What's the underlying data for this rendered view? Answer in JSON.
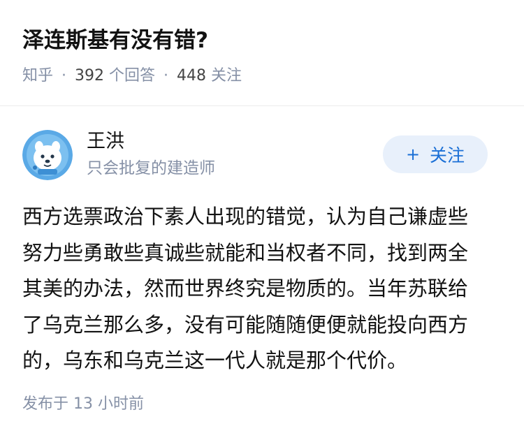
{
  "question": {
    "title": "泽连斯基有没有错?",
    "source": "知乎",
    "answer_count": "392",
    "answer_label": "个回答",
    "follower_count": "448",
    "follower_label": "关注"
  },
  "author": {
    "name": "王洪",
    "headline": "只会批复的建造师",
    "avatar": "robot-dog-avatar-icon",
    "follow_label": "关注",
    "follow_icon": "+"
  },
  "answer": {
    "lines": [
      "西方选票政治下素人出现的错觉，认为自己谦虚些",
      "努力些勇敢些真诚些就能和当权者不同，找到两全",
      "其美的办法，然而世界终究是物质的。当年苏联给",
      "了乌克兰那么多，没有可能随随便便就能投向西方",
      "的，乌东和乌克兰这一代人就是那个代价。"
    ],
    "publish_label": "发布于",
    "publish_time": "13 小时前"
  },
  "colors": {
    "accent": "#1a6fd6",
    "follow_bg": "#e8f0fb",
    "meta_text": "#8590a6",
    "avatar_bg": "#5aa9e6"
  }
}
